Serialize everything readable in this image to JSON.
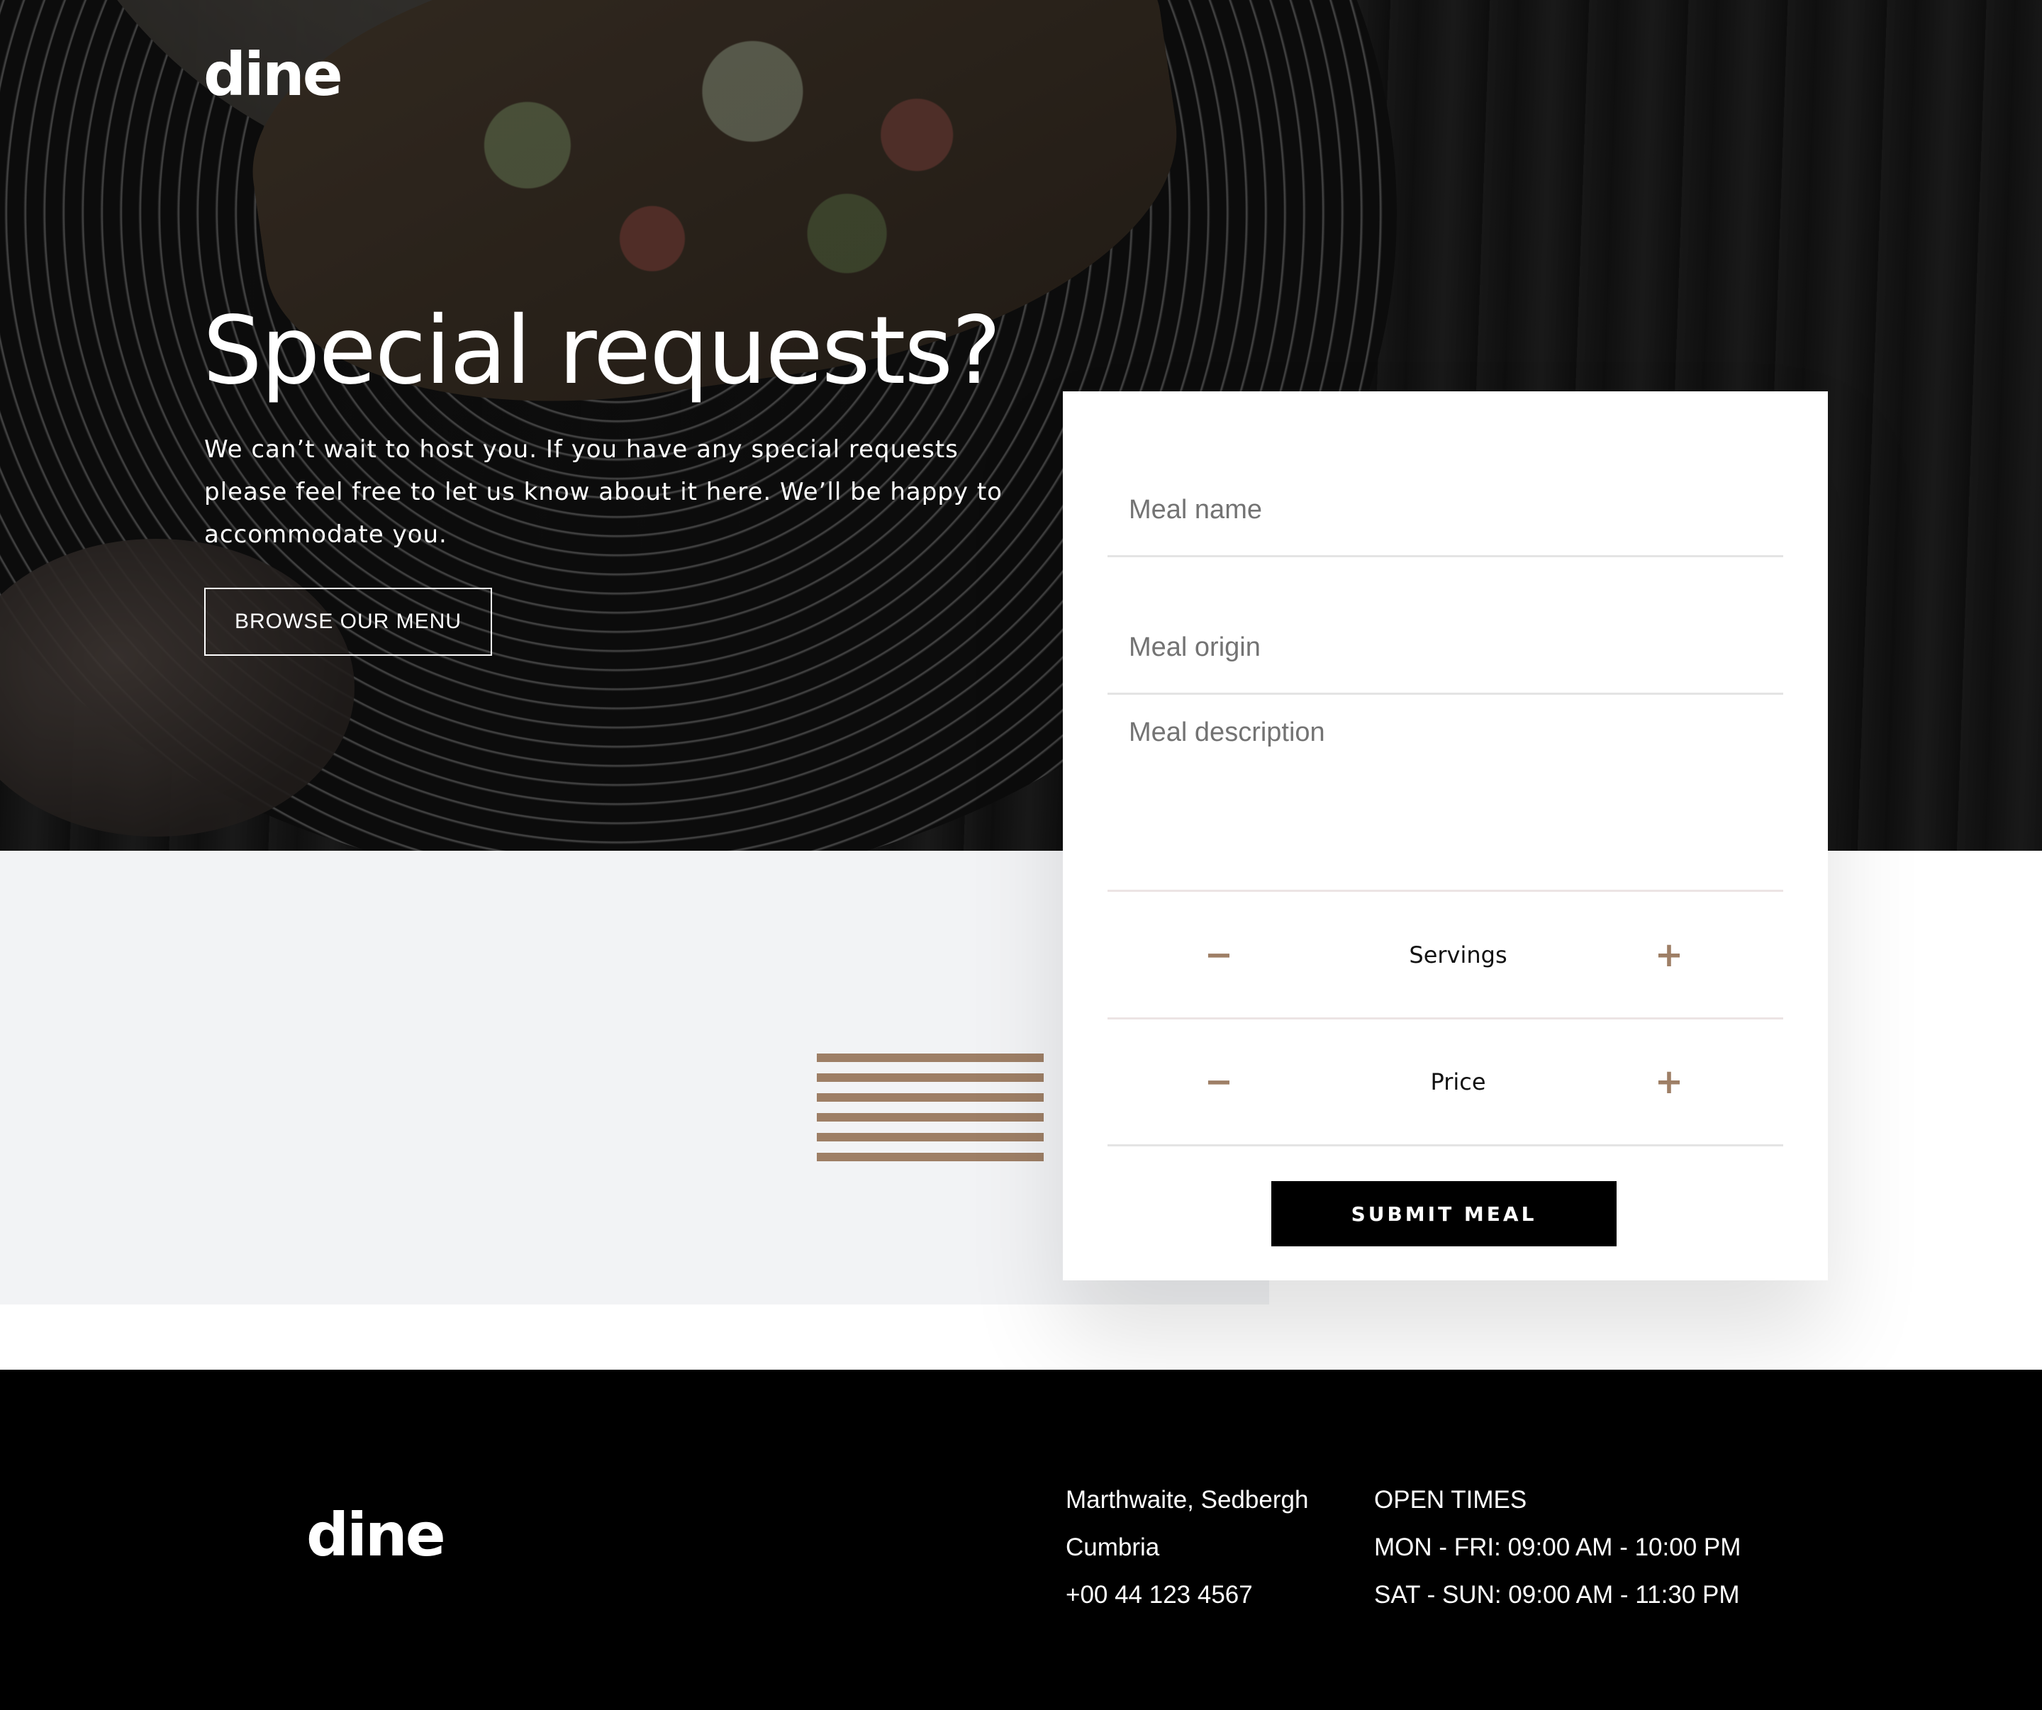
{
  "brand": {
    "logo": "dine",
    "accent_color": "#9e7f66"
  },
  "hero": {
    "title": "Special requests?",
    "text": "We can’t wait to host you. If you have any special requests please feel free to let us know about it here. We’ll be happy to accommodate you.",
    "browse_button": "BROWSE OUR MENU"
  },
  "form": {
    "meal_name_placeholder": "Meal name",
    "meal_origin_placeholder": "Meal origin",
    "meal_description_placeholder": "Meal description",
    "servings_label": "Servings",
    "price_label": "Price",
    "minus_symbol": "−",
    "plus_symbol": "+",
    "submit_label": "SUBMIT MEAL"
  },
  "footer": {
    "logo": "dine",
    "address": [
      "Marthwaite, Sedbergh",
      "Cumbria",
      "+00 44 123 4567"
    ],
    "hours": [
      "OPEN TIMES",
      "MON - FRI: 09:00 AM - 10:00 PM",
      "SAT - SUN: 09:00 AM - 11:30 PM"
    ]
  }
}
